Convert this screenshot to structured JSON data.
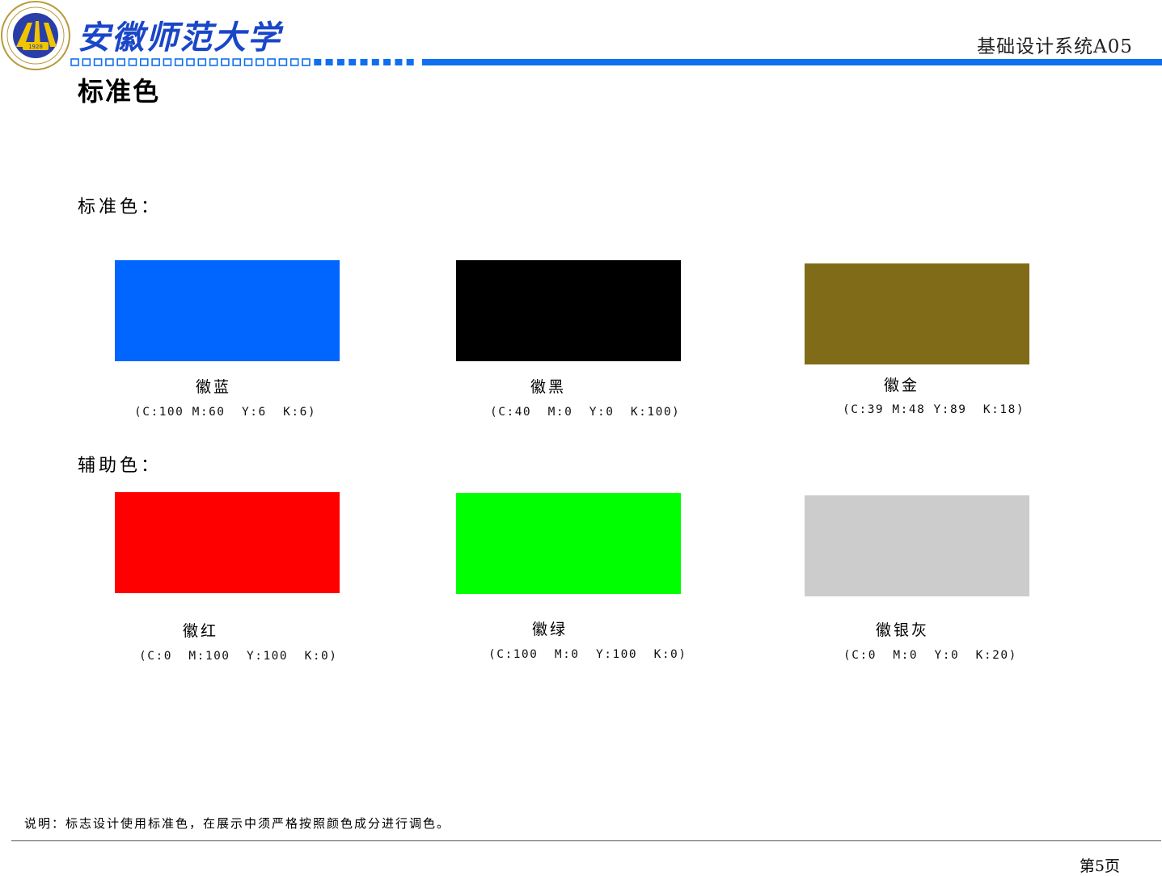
{
  "header": {
    "university_name": "安徽师范大学",
    "emblem": {
      "icon": "university-emblem-icon",
      "year": "1928",
      "english_name": "ANHUI NORMAL UNIVERSITY"
    },
    "system_code": "基础设计系统A05",
    "accent_color": "#0f6ff0"
  },
  "page": {
    "heading": "标准色"
  },
  "sections": {
    "primary": {
      "label": "标准色：",
      "colors": [
        {
          "name": "徽蓝",
          "cmyk": "(C:100 M:60  Y:6  K:6)",
          "hex": "#0066ff"
        },
        {
          "name": "徽黑",
          "cmyk": "(C:40  M:0  Y:0  K:100)",
          "hex": "#000000"
        },
        {
          "name": "徽金",
          "cmyk": "(C:39 M:48 Y:89  K:18)",
          "hex": "#806b19"
        }
      ]
    },
    "secondary": {
      "label": "辅助色：",
      "colors": [
        {
          "name": "徽红",
          "cmyk": "(C:0  M:100  Y:100  K:0)",
          "hex": "#ff0000"
        },
        {
          "name": "徽绿",
          "cmyk": "(C:100  M:0  Y:100  K:0)",
          "hex": "#00ff00"
        },
        {
          "name": "徽银灰",
          "cmyk": "(C:0  M:0  Y:0  K:20)",
          "hex": "#cccccc"
        }
      ]
    }
  },
  "footer": {
    "note": "说明：标志设计使用标准色，在展示中须严格按照颜色成分进行调色。",
    "page_number": "第5页"
  }
}
